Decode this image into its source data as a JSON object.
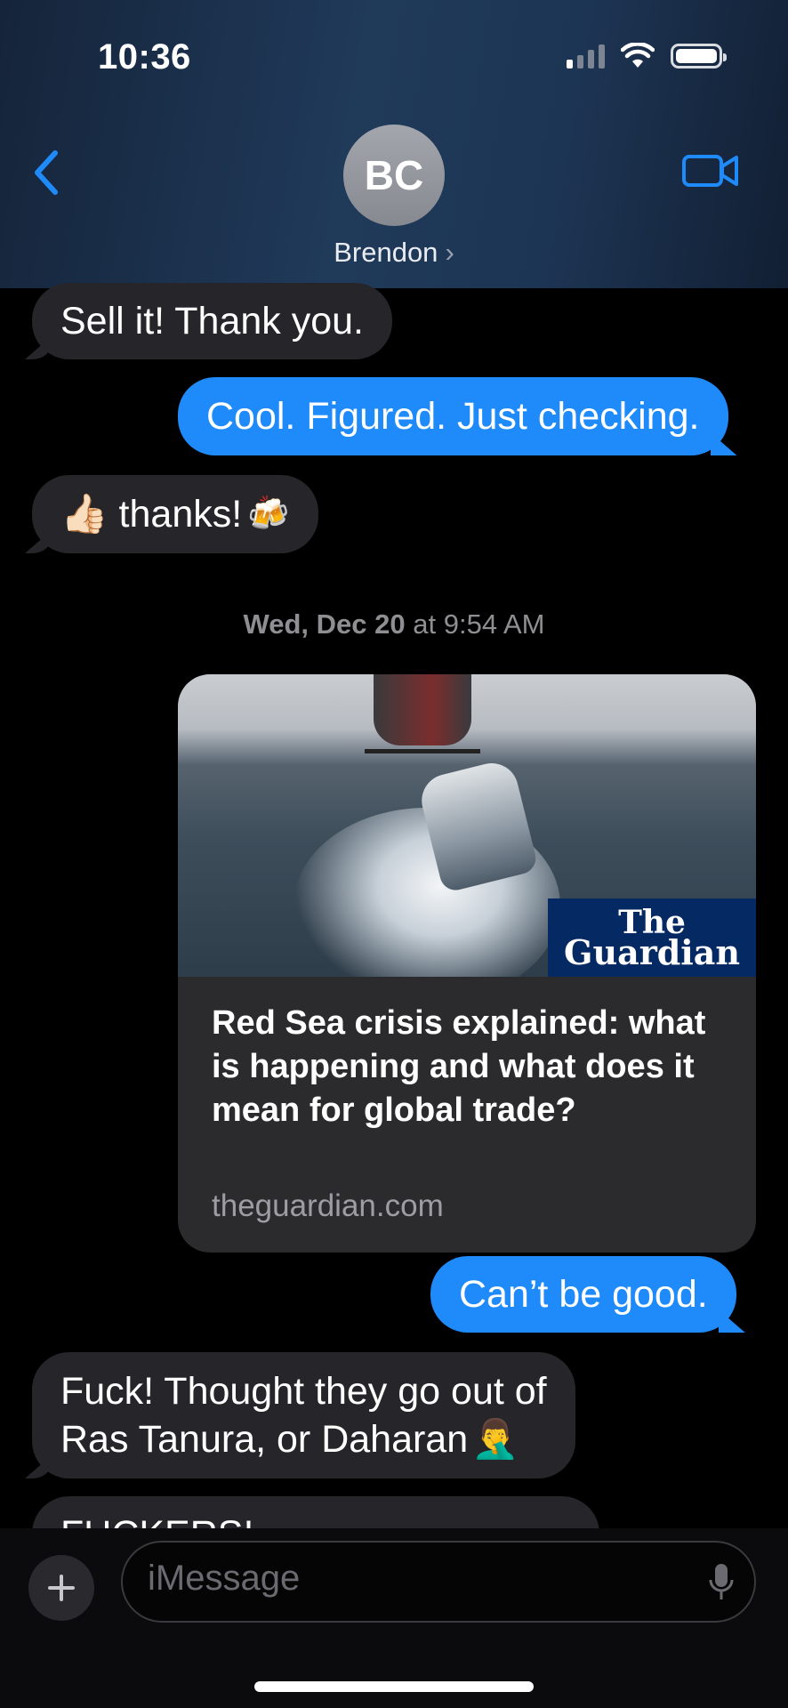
{
  "status_bar": {
    "time": "10:36",
    "cellular_bars_active": 1,
    "battery_level": 1.0
  },
  "header": {
    "avatar_initials": "BC",
    "contact_name": "Brendon",
    "name_chevron": "›",
    "back_icon": "chevron-left-icon",
    "video_icon": "video-camera-icon"
  },
  "messages": [
    {
      "direction": "incoming",
      "text": "Sell it! Thank you."
    },
    {
      "direction": "outgoing",
      "text": "Cool. Figured. Just checking."
    },
    {
      "direction": "incoming",
      "emoji_start": "👍🏻",
      "text": "thanks!",
      "emoji_end": "🍻"
    }
  ],
  "timestamp": {
    "day": "Wed, Dec 20",
    "at": "at",
    "time": "9:54 AM"
  },
  "link_preview": {
    "publisher_line1": "The",
    "publisher_line2": "Guardian",
    "title": "Red Sea crisis explained: what is happening and what does it mean for global trade?",
    "domain": "theguardian.com"
  },
  "messages_after": [
    {
      "direction": "outgoing",
      "text": "Can’t be good."
    },
    {
      "direction": "incoming",
      "line1": "Fuck! Thought they go out of",
      "line2": "Ras Tanura, or Daharan",
      "emoji_end": "🤦‍♂️"
    },
    {
      "direction": "incoming",
      "text": "FUCKERS!"
    }
  ],
  "composer": {
    "placeholder": "iMessage",
    "plus_label": "+",
    "mic_icon": "microphone-icon"
  },
  "colors": {
    "outgoing_bubble": "#1f8bfa",
    "incoming_bubble": "#26262a",
    "accent": "#1f8bfa"
  }
}
